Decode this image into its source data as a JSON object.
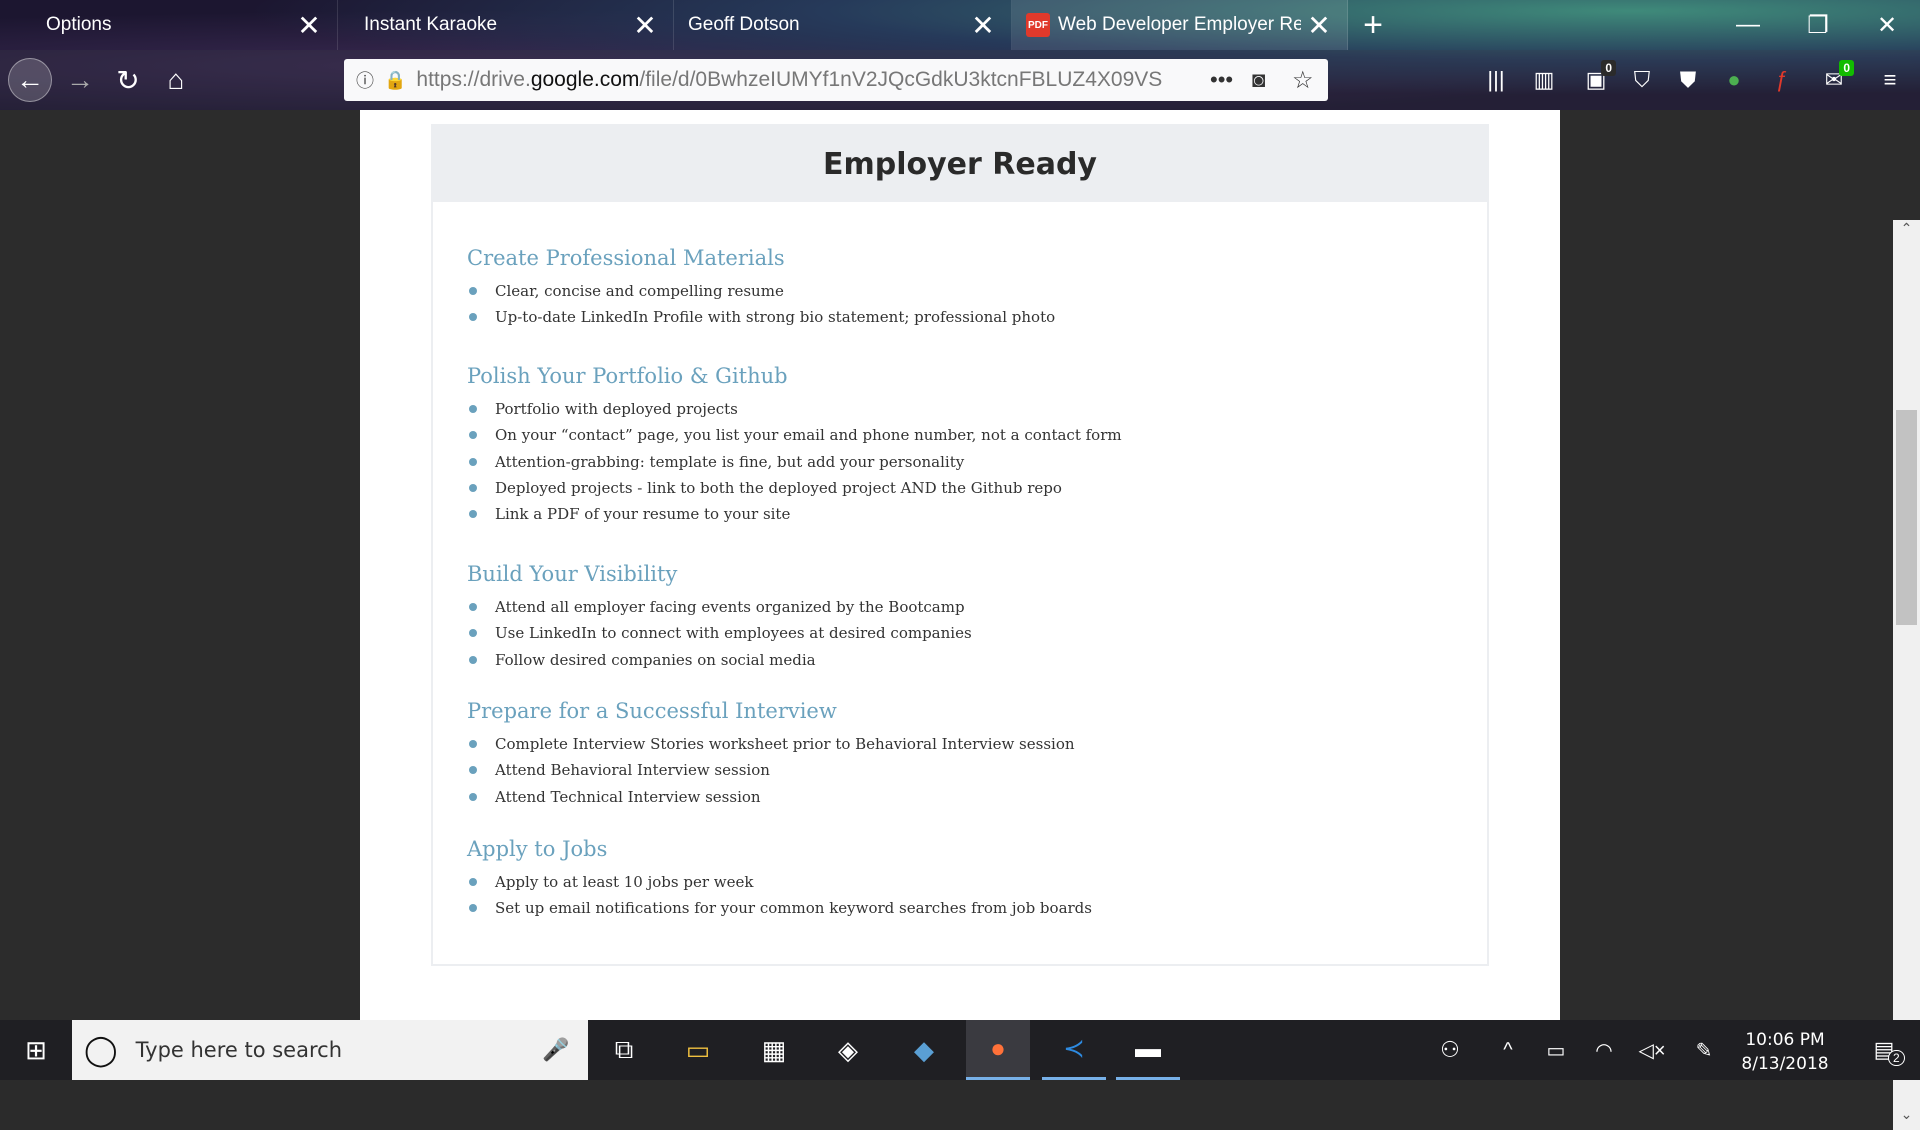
{
  "browser": {
    "tabs": [
      {
        "label": "Options"
      },
      {
        "label": "Instant Karaoke"
      },
      {
        "label": "Geoff Dotson"
      },
      {
        "label": "Web Developer Employer Ready",
        "badge": "PDF",
        "active": true
      }
    ],
    "close_glyph": "✕",
    "new_tab_glyph": "+",
    "url_scheme": "https://drive.",
    "url_domain": "google.com",
    "url_path": "/file/d/0BwhzeIUMYf1nV2JQcGdkU3ktcnFBLUZ4X09VS",
    "badge_counts": {
      "toolbar_ext_1": "0",
      "toolbar_ext_2": "0"
    }
  },
  "document": {
    "title": "Employer Ready",
    "sections": [
      {
        "heading": "Create Professional Materials",
        "items": [
          "Clear, concise and compelling resume",
          "Up-to-date LinkedIn Profile with strong bio statement; professional photo"
        ]
      },
      {
        "heading": "Polish Your Portfolio & Github",
        "items": [
          "Portfolio with deployed projects",
          "On your “contact” page, you list your email and phone number, not a contact form",
          "Attention-grabbing: template is fine, but add your personality",
          "Deployed projects - link to both the deployed project AND the Github repo",
          "Link a PDF of your resume to your site"
        ]
      },
      {
        "heading": "Build Your Visibility",
        "items": [
          "Attend all employer facing events organized by the Bootcamp",
          "Use LinkedIn to connect with employees at desired companies",
          "Follow desired companies on social media"
        ]
      },
      {
        "heading": "Prepare for a Successful Interview",
        "items": [
          "Complete Interview Stories worksheet prior to Behavioral Interview session",
          "Attend Behavioral Interview session",
          "Attend Technical Interview session"
        ]
      },
      {
        "heading": "Apply to Jobs",
        "items": [
          "Apply to at least 10 jobs per week",
          "Set up email notifications for your common keyword searches from job boards"
        ]
      }
    ]
  },
  "taskbar": {
    "search_placeholder": "Type here to search",
    "time": "10:06 PM",
    "date": "8/13/2018",
    "notification_count": "2"
  },
  "colors": {
    "accent_heading": "#6aa1bd",
    "pdf_badge": "#e0392b",
    "taskbar_active": "#77b0e8"
  }
}
